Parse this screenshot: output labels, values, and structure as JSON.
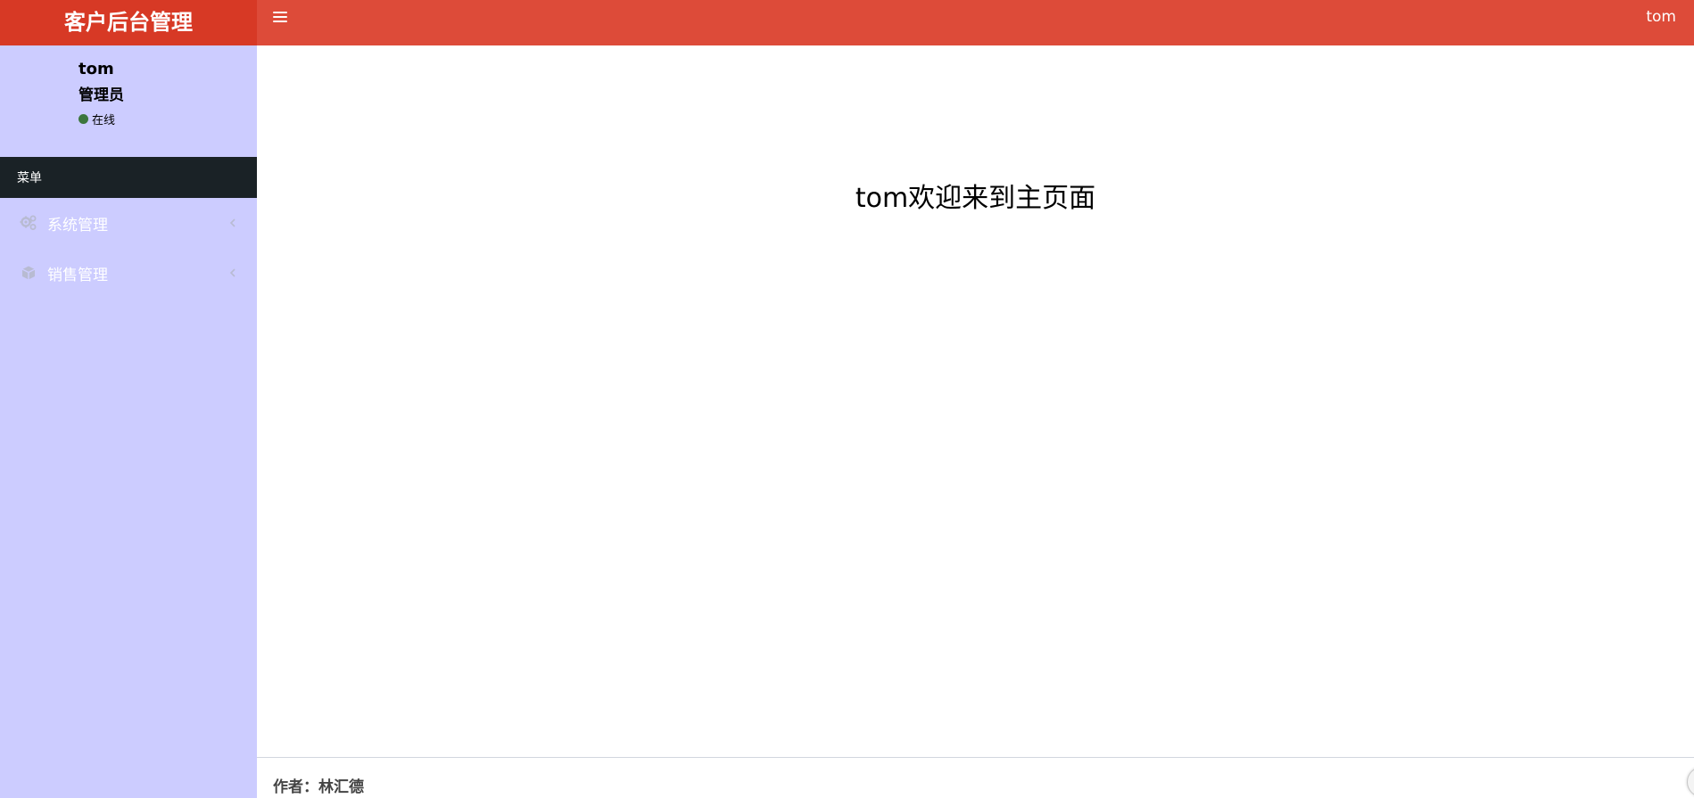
{
  "header": {
    "brand": "客户后台管理",
    "user": "tom",
    "menu_toggle_icon": "bars-icon"
  },
  "user_panel": {
    "name": "tom",
    "role": "管理员",
    "status": "在线",
    "status_color": "#3c763d"
  },
  "sidebar": {
    "menu_header": "菜单",
    "items": [
      {
        "label": "系统管理",
        "icon": "gears-icon"
      },
      {
        "label": "销售管理",
        "icon": "cube-icon"
      }
    ]
  },
  "main": {
    "welcome": "tom欢迎来到主页面"
  },
  "footer": {
    "author": "作者：林汇德"
  },
  "colors": {
    "brand_bg": "#d73925",
    "navbar_bg": "#dd4b39",
    "sidebar_bg": "#ccccff",
    "menu_header_bg": "#1a2226"
  }
}
